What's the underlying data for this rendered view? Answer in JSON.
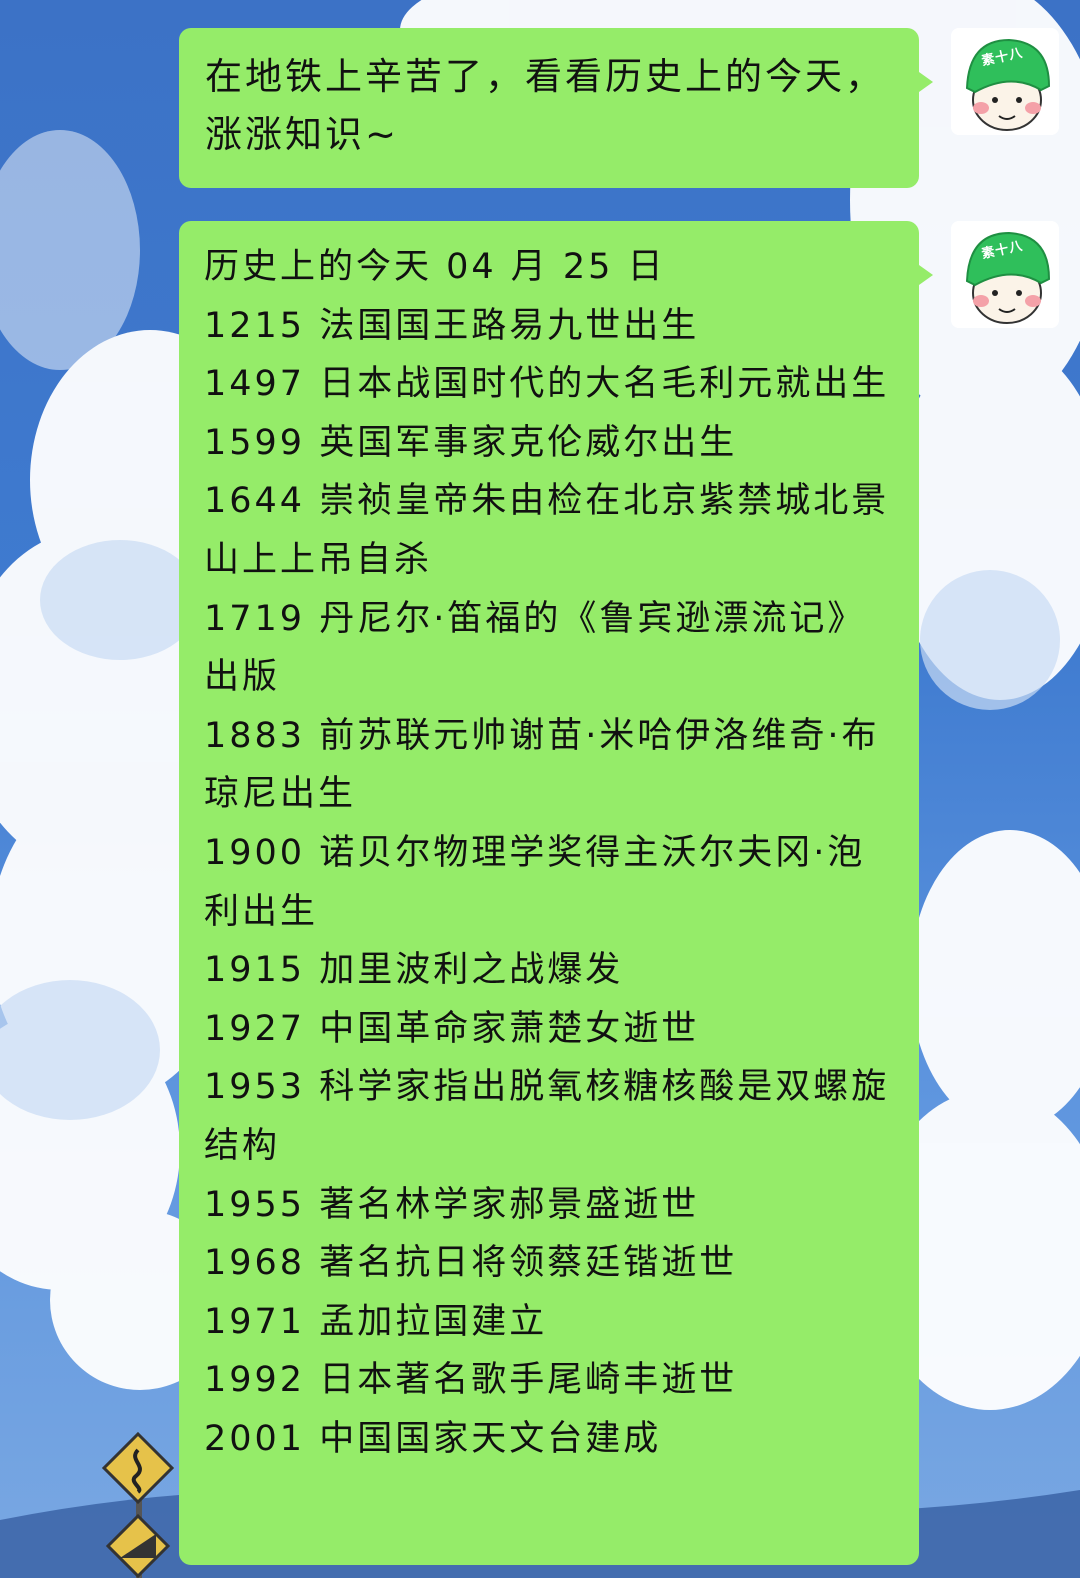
{
  "messages": [
    {
      "text": "在地铁上辛苦了，看看历史上的今天，涨涨知识~",
      "avatar_text": "素十八"
    },
    {
      "avatar_text": "素十八",
      "header": "历史上的今天 04 月 25 日",
      "events": [
        "1215 法国国王路易九世出生",
        "1497 日本战国时代的大名毛利元就出生",
        "1599 英国军事家克伦威尔出生",
        "1644 崇祯皇帝朱由检在北京紫禁城北景山上上吊自杀",
        "1719 丹尼尔·笛福的《鲁宾逊漂流记》出版",
        "1883 前苏联元帅谢苗·米哈伊洛维奇·布琼尼出生",
        "1900 诺贝尔物理学奖得主沃尔夫冈·泡利出生",
        "1915 加里波利之战爆发",
        "1927 中国革命家萧楚女逝世",
        "1953 科学家指出脱氧核糖核酸是双螺旋结构",
        "1955 著名林学家郝景盛逝世",
        "1968 著名抗日将领蔡廷锴逝世",
        "1971 孟加拉国建立",
        "1992 日本著名歌手尾崎丰逝世",
        "2001 中国国家天文台建成"
      ]
    }
  ],
  "colors": {
    "bubble": "#95ec69",
    "sky": "#3f7bd0",
    "helmet": "#2fbf5b"
  },
  "icons": [
    "cartoon-avatar-icon",
    "winding-road-sign-icon",
    "slope-sign-icon"
  ]
}
